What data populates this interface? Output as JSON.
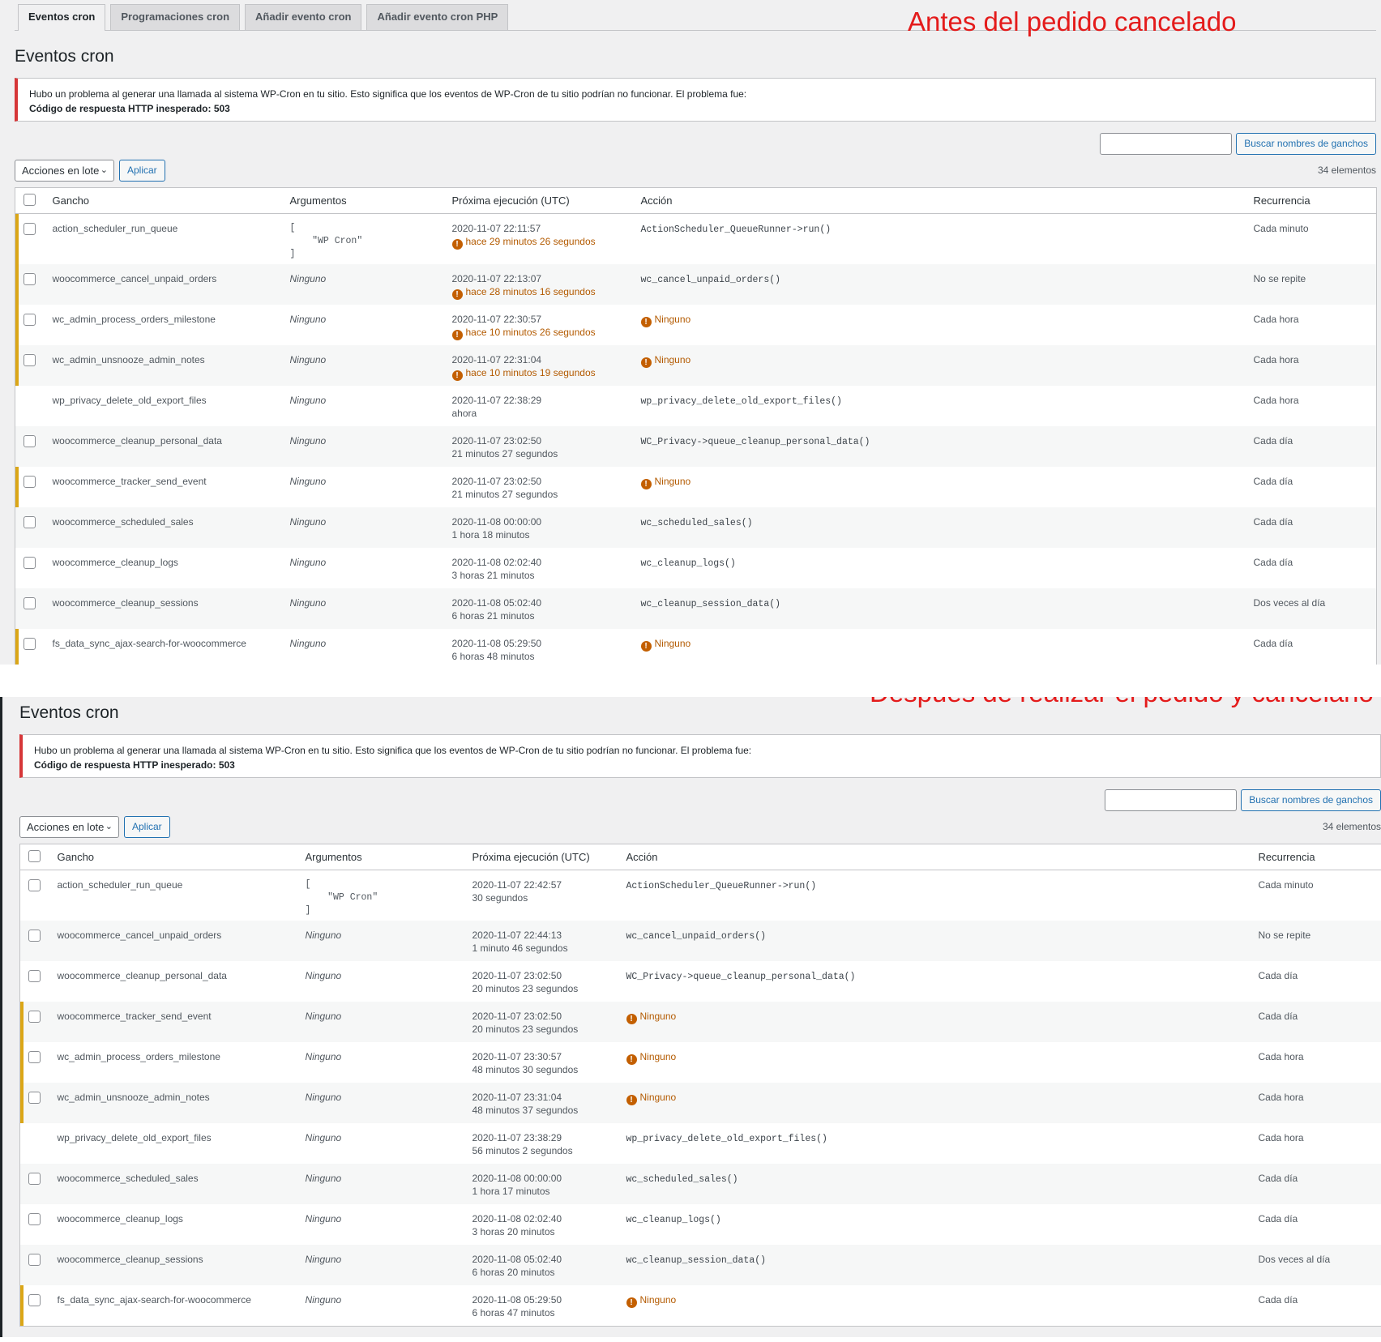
{
  "annotations": {
    "before": "Antes del pedido cancelado",
    "after": "Despues de realizar el pedido y cancelarlo"
  },
  "tabs": [
    "Eventos cron",
    "Programaciones cron",
    "Añadir evento cron",
    "Añadir evento cron PHP"
  ],
  "page_title": "Eventos cron",
  "notice": {
    "line1": "Hubo un problema al generar una llamada al sistema WP-Cron en tu sitio. Esto significa que los eventos de WP-Cron de tu sitio podrían no funcionar. El problema fue:",
    "line2": "Código de respuesta HTTP inesperado: 503"
  },
  "search_button": "Buscar nombres de ganchos",
  "bulk_select": "Acciones en lote",
  "apply_button": "Aplicar",
  "item_count": "34 elementos",
  "columns": {
    "hook": "Gancho",
    "args": "Argumentos",
    "next": "Próxima ejecución (UTC)",
    "action": "Acción",
    "recurrence": "Recurrencia"
  },
  "args_array": [
    "[",
    "    \"WP Cron\"",
    "]"
  ],
  "none_label": "Ninguno",
  "before": [
    {
      "hook": "action_scheduler_run_queue",
      "args": "array",
      "date": "2020-11-07 22:11:57",
      "rel": "hace 29 minutos 26 segundos",
      "late": true,
      "action": "ActionScheduler_QueueRunner->run()",
      "action_none": false,
      "recurrence": "Cada minuto",
      "warn": true,
      "checkbox": true
    },
    {
      "hook": "woocommerce_cancel_unpaid_orders",
      "args": "Ninguno",
      "date": "2020-11-07 22:13:07",
      "rel": "hace 28 minutos 16 segundos",
      "late": true,
      "action": "wc_cancel_unpaid_orders()",
      "action_none": false,
      "recurrence": "No se repite",
      "warn": true,
      "checkbox": true
    },
    {
      "hook": "wc_admin_process_orders_milestone",
      "args": "Ninguno",
      "date": "2020-11-07 22:30:57",
      "rel": "hace 10 minutos 26 segundos",
      "late": true,
      "action": "Ninguno",
      "action_none": true,
      "recurrence": "Cada hora",
      "warn": true,
      "checkbox": true
    },
    {
      "hook": "wc_admin_unsnooze_admin_notes",
      "args": "Ninguno",
      "date": "2020-11-07 22:31:04",
      "rel": "hace 10 minutos 19 segundos",
      "late": true,
      "action": "Ninguno",
      "action_none": true,
      "recurrence": "Cada hora",
      "warn": true,
      "checkbox": true
    },
    {
      "hook": "wp_privacy_delete_old_export_files",
      "args": "Ninguno",
      "date": "2020-11-07 22:38:29",
      "rel": "ahora",
      "late": false,
      "action": "wp_privacy_delete_old_export_files()",
      "action_none": false,
      "recurrence": "Cada hora",
      "warn": false,
      "checkbox": false
    },
    {
      "hook": "woocommerce_cleanup_personal_data",
      "args": "Ninguno",
      "date": "2020-11-07 23:02:50",
      "rel": "21 minutos 27 segundos",
      "late": false,
      "action": "WC_Privacy->queue_cleanup_personal_data()",
      "action_none": false,
      "recurrence": "Cada día",
      "warn": false,
      "checkbox": true
    },
    {
      "hook": "woocommerce_tracker_send_event",
      "args": "Ninguno",
      "date": "2020-11-07 23:02:50",
      "rel": "21 minutos 27 segundos",
      "late": false,
      "action": "Ninguno",
      "action_none": true,
      "recurrence": "Cada día",
      "warn": true,
      "checkbox": true
    },
    {
      "hook": "woocommerce_scheduled_sales",
      "args": "Ninguno",
      "date": "2020-11-08 00:00:00",
      "rel": "1 hora 18 minutos",
      "late": false,
      "action": "wc_scheduled_sales()",
      "action_none": false,
      "recurrence": "Cada día",
      "warn": false,
      "checkbox": true
    },
    {
      "hook": "woocommerce_cleanup_logs",
      "args": "Ninguno",
      "date": "2020-11-08 02:02:40",
      "rel": "3 horas 21 minutos",
      "late": false,
      "action": "wc_cleanup_logs()",
      "action_none": false,
      "recurrence": "Cada día",
      "warn": false,
      "checkbox": true
    },
    {
      "hook": "woocommerce_cleanup_sessions",
      "args": "Ninguno",
      "date": "2020-11-08 05:02:40",
      "rel": "6 horas 21 minutos",
      "late": false,
      "action": "wc_cleanup_session_data()",
      "action_none": false,
      "recurrence": "Dos veces al día",
      "warn": false,
      "checkbox": true
    },
    {
      "hook": "fs_data_sync_ajax-search-for-woocommerce",
      "args": "Ninguno",
      "date": "2020-11-08 05:29:50",
      "rel": "6 horas 48 minutos",
      "late": false,
      "action": "Ninguno",
      "action_none": true,
      "recurrence": "Cada día",
      "warn": true,
      "checkbox": true
    }
  ],
  "after": [
    {
      "hook": "action_scheduler_run_queue",
      "args": "array",
      "date": "2020-11-07 22:42:57",
      "rel": "30 segundos",
      "late": false,
      "action": "ActionScheduler_QueueRunner->run()",
      "action_none": false,
      "recurrence": "Cada minuto",
      "warn": false,
      "checkbox": true
    },
    {
      "hook": "woocommerce_cancel_unpaid_orders",
      "args": "Ninguno",
      "date": "2020-11-07 22:44:13",
      "rel": "1 minuto 46 segundos",
      "late": false,
      "action": "wc_cancel_unpaid_orders()",
      "action_none": false,
      "recurrence": "No se repite",
      "warn": false,
      "checkbox": true
    },
    {
      "hook": "woocommerce_cleanup_personal_data",
      "args": "Ninguno",
      "date": "2020-11-07 23:02:50",
      "rel": "20 minutos 23 segundos",
      "late": false,
      "action": "WC_Privacy->queue_cleanup_personal_data()",
      "action_none": false,
      "recurrence": "Cada día",
      "warn": false,
      "checkbox": true
    },
    {
      "hook": "woocommerce_tracker_send_event",
      "args": "Ninguno",
      "date": "2020-11-07 23:02:50",
      "rel": "20 minutos 23 segundos",
      "late": false,
      "action": "Ninguno",
      "action_none": true,
      "recurrence": "Cada día",
      "warn": true,
      "checkbox": true
    },
    {
      "hook": "wc_admin_process_orders_milestone",
      "args": "Ninguno",
      "date": "2020-11-07 23:30:57",
      "rel": "48 minutos 30 segundos",
      "late": false,
      "action": "Ninguno",
      "action_none": true,
      "recurrence": "Cada hora",
      "warn": true,
      "checkbox": true
    },
    {
      "hook": "wc_admin_unsnooze_admin_notes",
      "args": "Ninguno",
      "date": "2020-11-07 23:31:04",
      "rel": "48 minutos 37 segundos",
      "late": false,
      "action": "Ninguno",
      "action_none": true,
      "recurrence": "Cada hora",
      "warn": true,
      "checkbox": true
    },
    {
      "hook": "wp_privacy_delete_old_export_files",
      "args": "Ninguno",
      "date": "2020-11-07 23:38:29",
      "rel": "56 minutos 2 segundos",
      "late": false,
      "action": "wp_privacy_delete_old_export_files()",
      "action_none": false,
      "recurrence": "Cada hora",
      "warn": false,
      "checkbox": false
    },
    {
      "hook": "woocommerce_scheduled_sales",
      "args": "Ninguno",
      "date": "2020-11-08 00:00:00",
      "rel": "1 hora 17 minutos",
      "late": false,
      "action": "wc_scheduled_sales()",
      "action_none": false,
      "recurrence": "Cada día",
      "warn": false,
      "checkbox": true
    },
    {
      "hook": "woocommerce_cleanup_logs",
      "args": "Ninguno",
      "date": "2020-11-08 02:02:40",
      "rel": "3 horas 20 minutos",
      "late": false,
      "action": "wc_cleanup_logs()",
      "action_none": false,
      "recurrence": "Cada día",
      "warn": false,
      "checkbox": true
    },
    {
      "hook": "woocommerce_cleanup_sessions",
      "args": "Ninguno",
      "date": "2020-11-08 05:02:40",
      "rel": "6 horas 20 minutos",
      "late": false,
      "action": "wc_cleanup_session_data()",
      "action_none": false,
      "recurrence": "Dos veces al día",
      "warn": false,
      "checkbox": true
    },
    {
      "hook": "fs_data_sync_ajax-search-for-woocommerce",
      "args": "Ninguno",
      "date": "2020-11-08 05:29:50",
      "rel": "6 horas 47 minutos",
      "late": false,
      "action": "Ninguno",
      "action_none": true,
      "recurrence": "Cada día",
      "warn": true,
      "checkbox": true
    }
  ]
}
